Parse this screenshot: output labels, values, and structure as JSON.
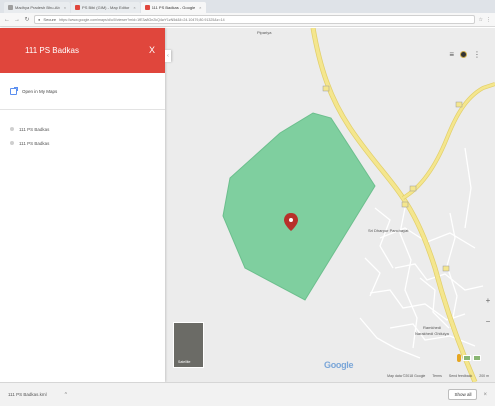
{
  "browser": {
    "tabs": [
      {
        "label": "Madhya Pradesh Bhu-Ab",
        "favicon_color": "#9e9e9e",
        "active": false
      },
      {
        "label": "PS Bibi (GIM) - Map Editor",
        "favicon_color": "#e0463c",
        "active": false
      },
      {
        "label": "111 PS Badkas - Google",
        "favicon_color": "#e0463c",
        "active": true
      }
    ],
    "tab_close_glyph": "×",
    "secure_label": "Secure",
    "url": "https://www.google.com/maps/d/u/0/viewer?mid=1fE3a8Gn2kQ4wY1zN5d&ll=24.10479,80.91325&z=14"
  },
  "panel": {
    "title": "111 PS Badkas",
    "close_glyph": "X",
    "open_label": "Open in My Maps",
    "layers": [
      {
        "label": "111 PS Badkas"
      },
      {
        "label": "111 PS Badkas"
      }
    ],
    "collapse_glyph": "‹"
  },
  "map": {
    "colors": {
      "background": "#ececec",
      "polygon_fill": "#7fcf9f",
      "polygon_stroke": "#6cbf8d",
      "major_road": "#f4e68e",
      "major_road_edge": "#e2cf6a",
      "minor_road": "#ffffff",
      "marker": "#b8302a"
    },
    "labels": {
      "place_top": "Pipariya",
      "locality": "Sri Dharpur Panchayat",
      "village_1": "Ramkhedi",
      "village_2": "Narakhedi Ghiluiya"
    },
    "satellite_label": "Satellite",
    "google_logo": "Google",
    "footer": [
      "Map data ©2018 Google",
      "Terms",
      "Send feedback",
      "200 m"
    ],
    "zoom_in_glyph": "+",
    "zoom_out_glyph": "−",
    "menu_glyph": "≡",
    "more_glyph": "⋮"
  },
  "downloads": {
    "file": "111 PS Badkas.kml",
    "caret": "^",
    "show_all": "Show all",
    "close_glyph": "×"
  }
}
